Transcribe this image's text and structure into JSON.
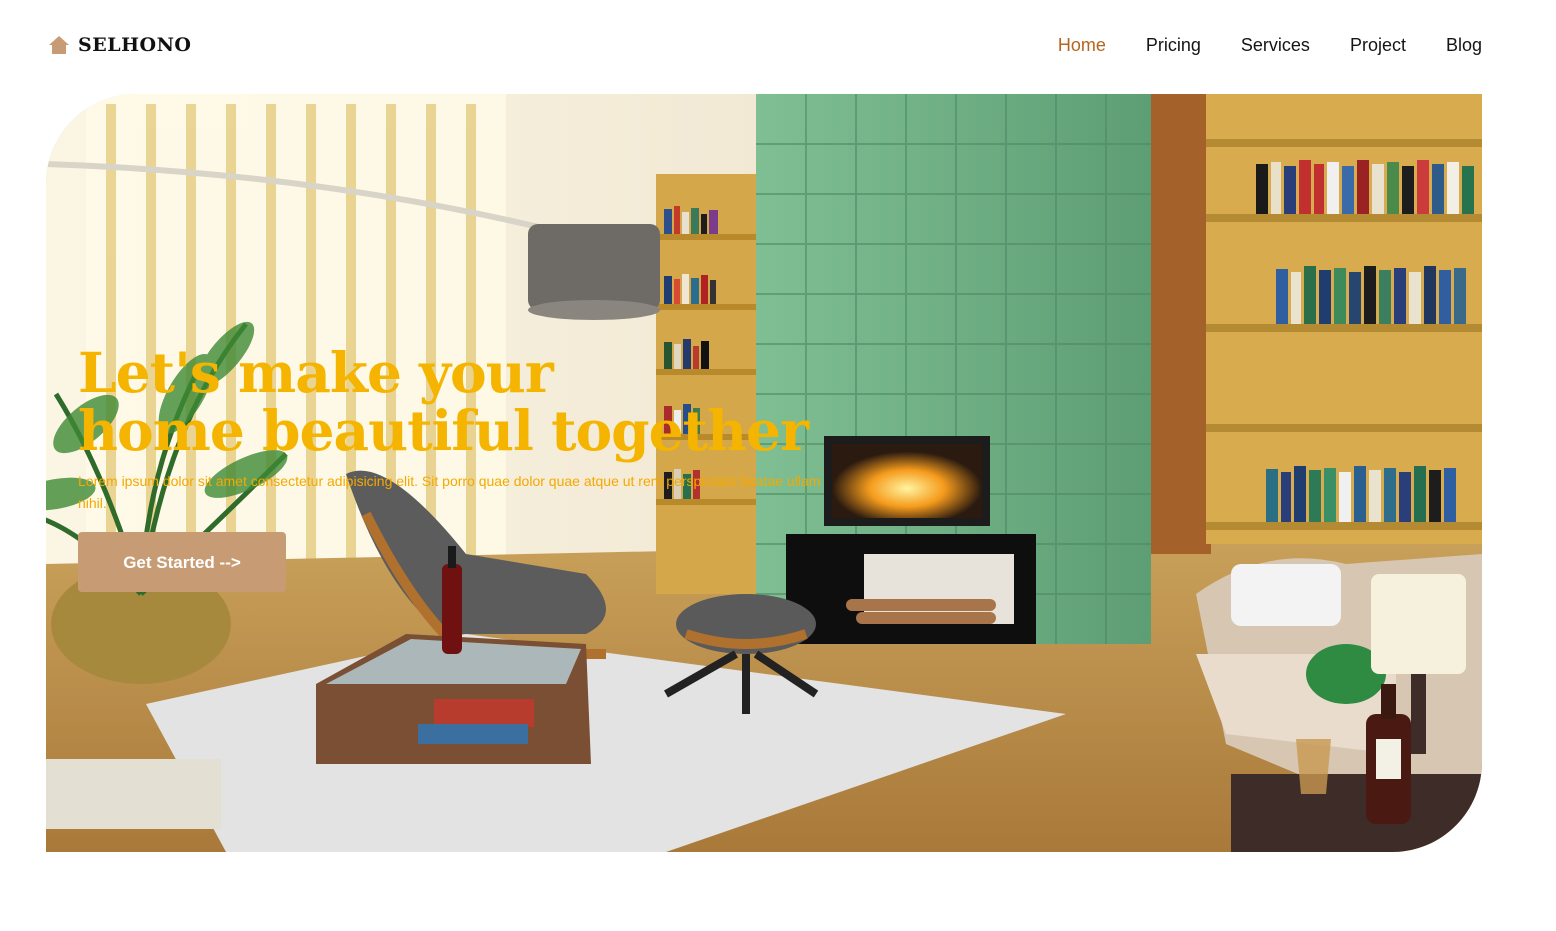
{
  "brand": {
    "name": "SELHONO",
    "icon": "home-icon"
  },
  "nav": {
    "items": [
      {
        "label": "Home",
        "active": true
      },
      {
        "label": "Pricing",
        "active": false
      },
      {
        "label": "Services",
        "active": false
      },
      {
        "label": "Project",
        "active": false
      },
      {
        "label": "Blog",
        "active": false
      }
    ]
  },
  "hero": {
    "title_line1": "Let's make your",
    "title_line2": "home beautiful together",
    "description": "Lorem ipsum dolor sit amet consectetur adipisicing elit. Sit porro quae dolor quae atque ut rem perspiciatis beatae ullam nihil.",
    "cta_label": "Get Started -->"
  },
  "colors": {
    "accent": "#b5651d",
    "title": "#f4b400",
    "button": "#c79c74"
  }
}
